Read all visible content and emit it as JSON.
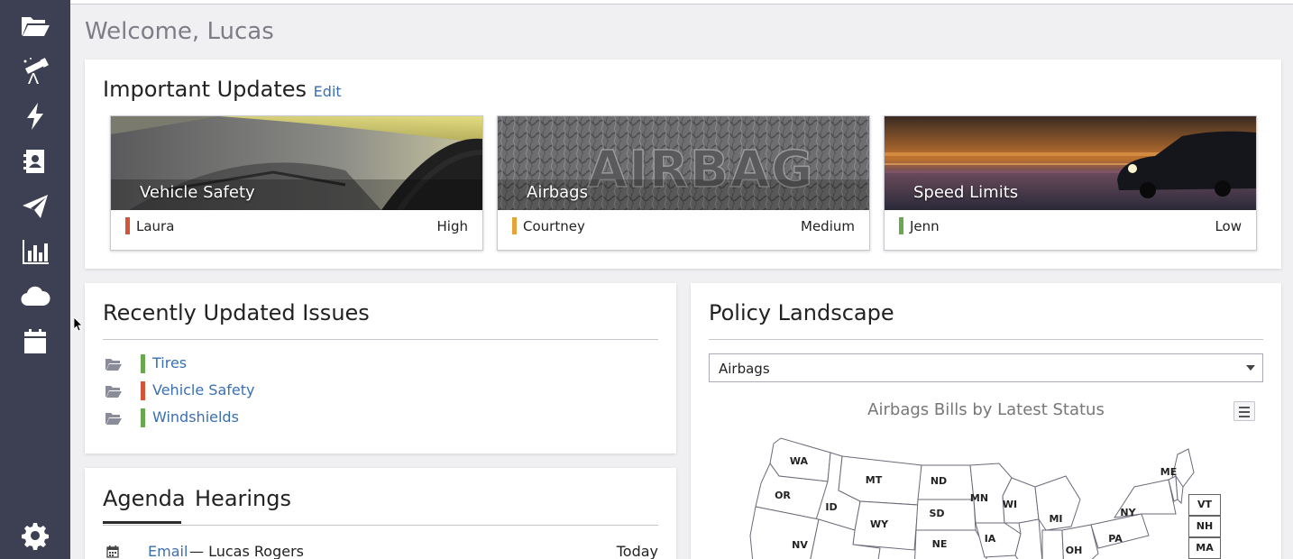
{
  "header": {
    "welcome": "Welcome, Lucas"
  },
  "sidebar": {
    "items": [
      {
        "icon": "folder-open-icon"
      },
      {
        "icon": "telescope-icon"
      },
      {
        "icon": "bolt-icon"
      },
      {
        "icon": "contact-book-icon"
      },
      {
        "icon": "paper-plane-icon"
      },
      {
        "icon": "bar-chart-icon"
      },
      {
        "icon": "cloud-icon"
      },
      {
        "icon": "calendar-icon"
      }
    ],
    "settings_icon": "gear-icon"
  },
  "updates": {
    "title": "Important Updates",
    "edit_label": "Edit",
    "cards": [
      {
        "title": "Vehicle Safety",
        "owner": "Laura",
        "priority": "High",
        "color": "#d4543a"
      },
      {
        "title": "Airbags",
        "owner": "Courtney",
        "priority": "Medium",
        "color": "#e8a23a"
      },
      {
        "title": "Speed Limits",
        "owner": "Jenn",
        "priority": "Low",
        "color": "#6aa84f"
      }
    ],
    "airbag_text": "AIRBAG"
  },
  "issues": {
    "title": "Recently Updated Issues",
    "items": [
      {
        "label": "Tires",
        "color": "#6aa84f"
      },
      {
        "label": "Vehicle Safety",
        "color": "#d4543a"
      },
      {
        "label": "Windshields",
        "color": "#6aa84f"
      }
    ]
  },
  "agenda": {
    "tabs": [
      "Agenda",
      "Hearings"
    ],
    "rows": [
      {
        "type": "Email",
        "who": "— Lucas Rogers",
        "when": "Today"
      }
    ]
  },
  "policy": {
    "title": "Policy Landscape",
    "selected": "Airbags",
    "map_title": "Airbags Bills by Latest Status",
    "states": [
      "WA",
      "OR",
      "MT",
      "ID",
      "WY",
      "ND",
      "SD",
      "NE",
      "MN",
      "WI",
      "IA",
      "MI",
      "NY",
      "PA",
      "OH",
      "ME",
      "NV"
    ],
    "ne_boxes": [
      "VT",
      "NH",
      "MA"
    ]
  }
}
